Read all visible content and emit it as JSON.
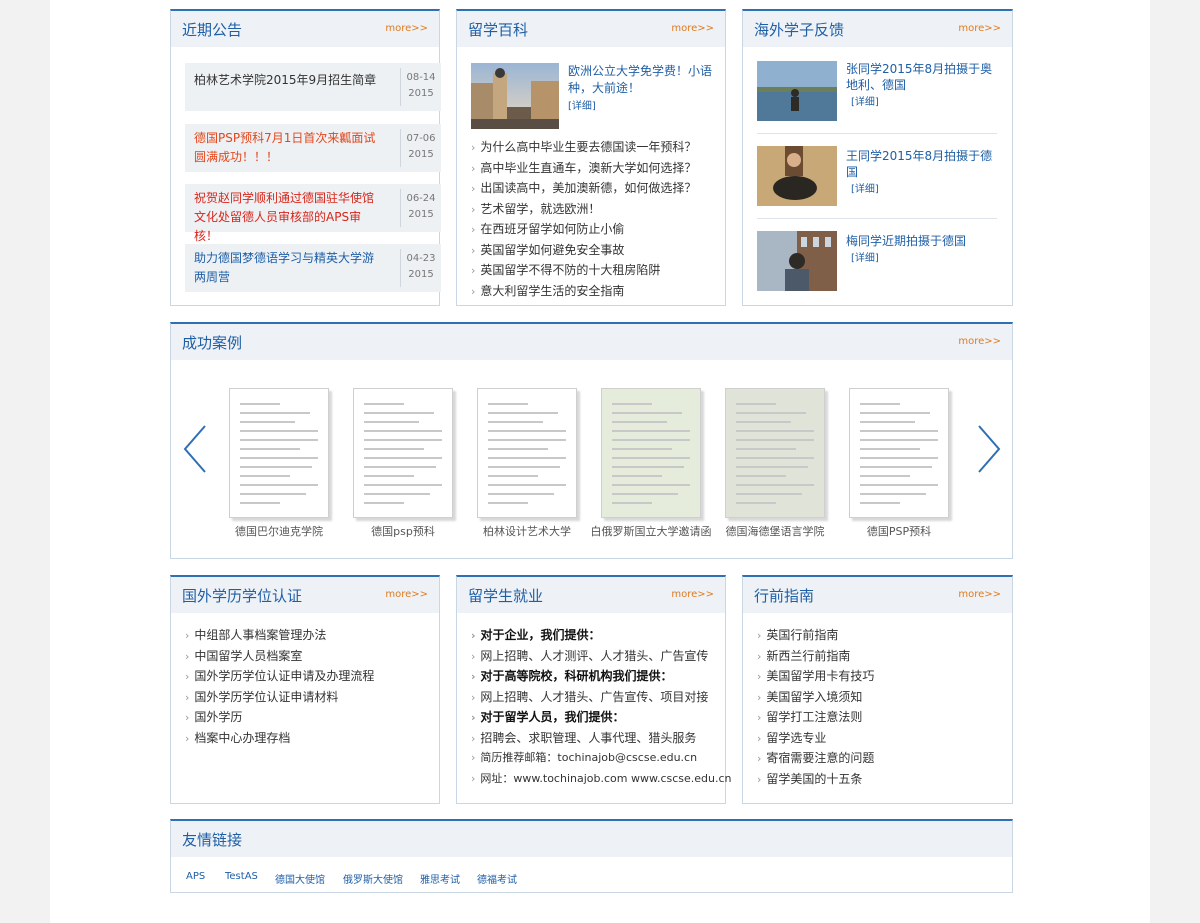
{
  "notices": {
    "title": "近期公告",
    "more": "more>>",
    "items": [
      {
        "text": "柏林艺术学院2015年9月招生简章",
        "date_md": "08-14",
        "year": "2015",
        "color": "#333333"
      },
      {
        "text": "德国PSP预科7月1日首次来瓤面试圆满成功！！！",
        "date_md": "07-06",
        "year": "2015",
        "color": "#e2461c"
      },
      {
        "text": "祝贺赵同学顺利通过德国驻华使馆文化处留德人员审核部的APS审核！",
        "date_md": "06-24",
        "year": "2015",
        "color": "#d7261a"
      },
      {
        "text": "助力德国梦德语学习与精英大学游两周营",
        "date_md": "04-23",
        "year": "2015",
        "color": "#1f5fa6"
      }
    ]
  },
  "encyclopedia": {
    "title": "留学百科",
    "more": "more>>",
    "featured_title": "欧洲公立大学免学费！小语种，大前途！",
    "featured_detail": "[详细]",
    "items": [
      "为什么高中毕业生要去德国读一年预科？",
      "高中毕业生直通车，澳新大学如何选择？",
      "出国读高中，美加澳新德，如何做选择？",
      "艺术留学，就选欧洲！",
      "在西班牙留学如何防止小偷",
      "英国留学如何避免安全事故",
      "英国留学不得不防的十大租房陷阱",
      "意大利留学生活的安全指南"
    ]
  },
  "feedback": {
    "title": "海外学子反馈",
    "more": "more>>",
    "items": [
      {
        "name": "张同学2015年8月拍摄于奥地利、德国",
        "detail": "[详细]"
      },
      {
        "name": "王同学2015年8月拍摄于德国",
        "detail": "[详细]"
      },
      {
        "name": "梅同学近期拍摄于德国",
        "detail": "[详细]"
      }
    ]
  },
  "cases": {
    "title": "成功案例",
    "more": "more>>",
    "items": [
      {
        "label": "德国巴尔迪克学院",
        "tint": "#ffffff"
      },
      {
        "label": "德国psp预科",
        "tint": "#ffffff"
      },
      {
        "label": "柏林设计艺术大学",
        "tint": "#ffffff"
      },
      {
        "label": "白俄罗斯国立大学邀请函",
        "tint": "#e6ecdc"
      },
      {
        "label": "德国海德堡语言学院",
        "tint": "#dfe3d8"
      },
      {
        "label": "德国PSP预科",
        "tint": "#ffffff"
      }
    ]
  },
  "degree": {
    "title": "国外学历学位认证",
    "more": "more>>",
    "items": [
      "中组部人事档案管理办法",
      "中国留学人员档案室",
      "国外学历学位认证申请及办理流程",
      "国外学历学位认证申请材料",
      "国外学历",
      "档案中心办理存档"
    ]
  },
  "employment": {
    "title": "留学生就业",
    "more": "more>>",
    "items": [
      {
        "text": "对于企业，我们提供：",
        "bold": true
      },
      {
        "text": "网上招聘、人才测评、人才猎头、广告宣传",
        "bold": false
      },
      {
        "text": "对于高等院校，科研机构我们提供：",
        "bold": true
      },
      {
        "text": "网上招聘、人才猎头、广告宣传、项目对接",
        "bold": false
      },
      {
        "text": "对于留学人员，我们提供：",
        "bold": true
      },
      {
        "text": "招聘会、求职管理、人事代理、猎头服务",
        "bold": false
      },
      {
        "text": "简历推荐邮箱：tochinajob@cscse.edu.cn",
        "bold": false
      },
      {
        "text": "网址：www.tochinajob.com www.cscse.edu.cn",
        "bold": false
      }
    ]
  },
  "guide": {
    "title": "行前指南",
    "more": "more>>",
    "items": [
      "英国行前指南",
      "新西兰行前指南",
      "美国留学用卡有技巧",
      "美国留学入境须知",
      "留学打工注意法则",
      "留学选专业",
      "寄宿需要注意的问题",
      "留学美国的十五条"
    ]
  },
  "friend_links": {
    "title": "友情链接",
    "items": [
      "APS",
      "TestAS",
      "德国大使馆",
      "俄罗斯大使馆",
      "雅思考试",
      "德福考试"
    ]
  },
  "icons": {
    "arrow": "›",
    "prev": "chevron-left-icon",
    "next": "chevron-right-icon"
  },
  "colors": {
    "accent": "#2f6fb3",
    "title": "#1f5fa6",
    "more": "#e07b20",
    "head_bg": "#eef2f6",
    "page_bg": "#f2f2f2"
  }
}
